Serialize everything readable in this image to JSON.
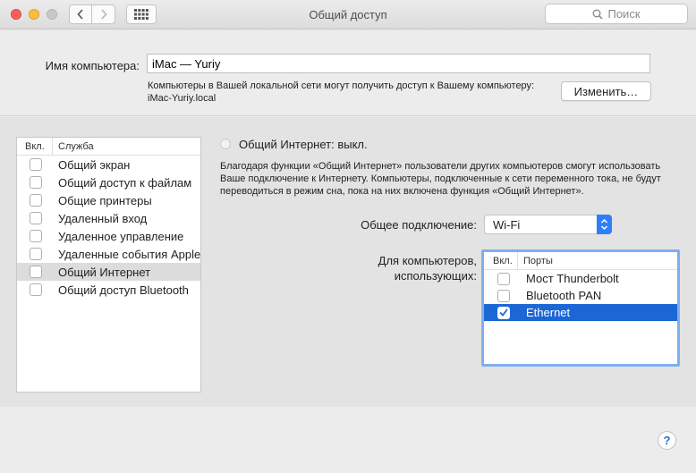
{
  "window": {
    "title": "Общий доступ"
  },
  "toolbar": {
    "search_placeholder": "Поиск"
  },
  "computer_name": {
    "label": "Имя компьютера:",
    "value": "iMac — Yuriy",
    "description": "Компьютеры в Вашей локальной сети могут получить доступ к Вашему компьютеру: iMac-Yuriy.local",
    "edit_button": "Изменить…"
  },
  "services": {
    "col_on": "Вкл.",
    "col_service": "Служба",
    "items": [
      {
        "label": "Общий экран",
        "checked": false
      },
      {
        "label": "Общий доступ к файлам",
        "checked": false
      },
      {
        "label": "Общие принтеры",
        "checked": false
      },
      {
        "label": "Удаленный вход",
        "checked": false
      },
      {
        "label": "Удаленное управление",
        "checked": false
      },
      {
        "label": "Удаленные события Apple",
        "checked": false
      },
      {
        "label": "Общий Интернет",
        "checked": false,
        "selected": true
      },
      {
        "label": "Общий доступ Bluetooth",
        "checked": false
      }
    ]
  },
  "detail": {
    "status": "Общий Интернет: выкл.",
    "description": "Благодаря функции «Общий Интернет» пользователи других компьютеров смогут использовать Ваше подключение к Интернету. Компьютеры, подключенные к сети переменного тока, не будут переводиться в режим сна, пока на них включена функция «Общий Интернет».",
    "share_from_label": "Общее подключение:",
    "share_from_value": "Wi-Fi",
    "to_label_1": "Для компьютеров,",
    "to_label_2": "использующих:",
    "ports_col_on": "Вкл.",
    "ports_col_ports": "Порты",
    "ports": [
      {
        "label": "Мост Thunderbolt",
        "checked": false
      },
      {
        "label": "Bluetooth PAN",
        "checked": false
      },
      {
        "label": "Ethernet",
        "checked": true,
        "selected": true
      }
    ]
  },
  "help_label": "?",
  "colors": {
    "accent": "#2d7ff9",
    "selection": "#1b67d6"
  }
}
